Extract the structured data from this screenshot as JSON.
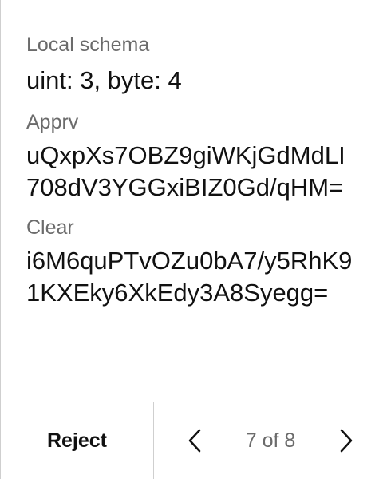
{
  "fields": {
    "schema": {
      "label": "Local schema",
      "value": "uint: 3, byte: 4"
    },
    "apprv": {
      "label": "Apprv",
      "value": "uQxpXs7OBZ9giWKjGdMdLI708dV3YGGxiBIZ0Gd/qHM="
    },
    "clear": {
      "label": "Clear",
      "value": "i6M6quPTvOZu0bA7/y5RhK91KXEky6XkEdy3A8Syegg="
    }
  },
  "footer": {
    "reject_label": "Reject",
    "page_indicator": "7 of 8",
    "prev_icon": "chevron-left-icon",
    "next_icon": "chevron-right-icon"
  }
}
